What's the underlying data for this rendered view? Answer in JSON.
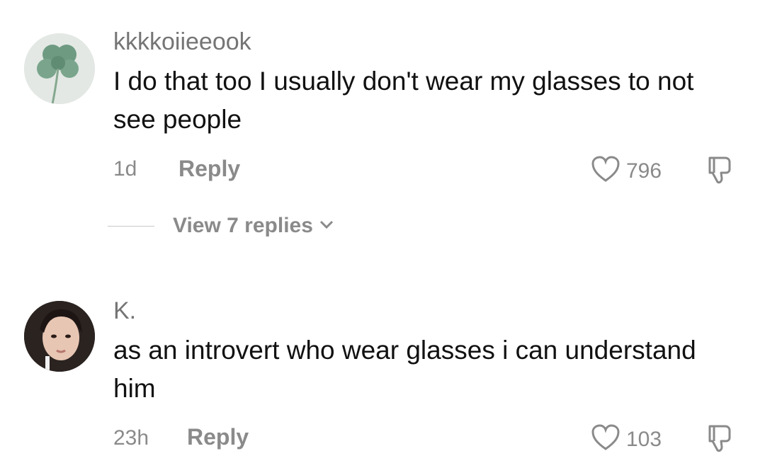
{
  "comments": [
    {
      "username": "kkkkoiieeook",
      "text": "I do that too I usually don't wear my glasses to not see people",
      "time": "1d",
      "reply_label": "Reply",
      "likes": "796",
      "view_replies": "View 7 replies"
    },
    {
      "username": "K.",
      "text": "as an introvert who wear glasses i can understand him",
      "time": "23h",
      "reply_label": "Reply",
      "likes": "103"
    }
  ],
  "colors": {
    "text": "#111111",
    "muted": "#8a8a8a",
    "username": "#757575"
  },
  "icons": [
    "heart-icon",
    "dislike-icon",
    "chevron-down-icon"
  ]
}
